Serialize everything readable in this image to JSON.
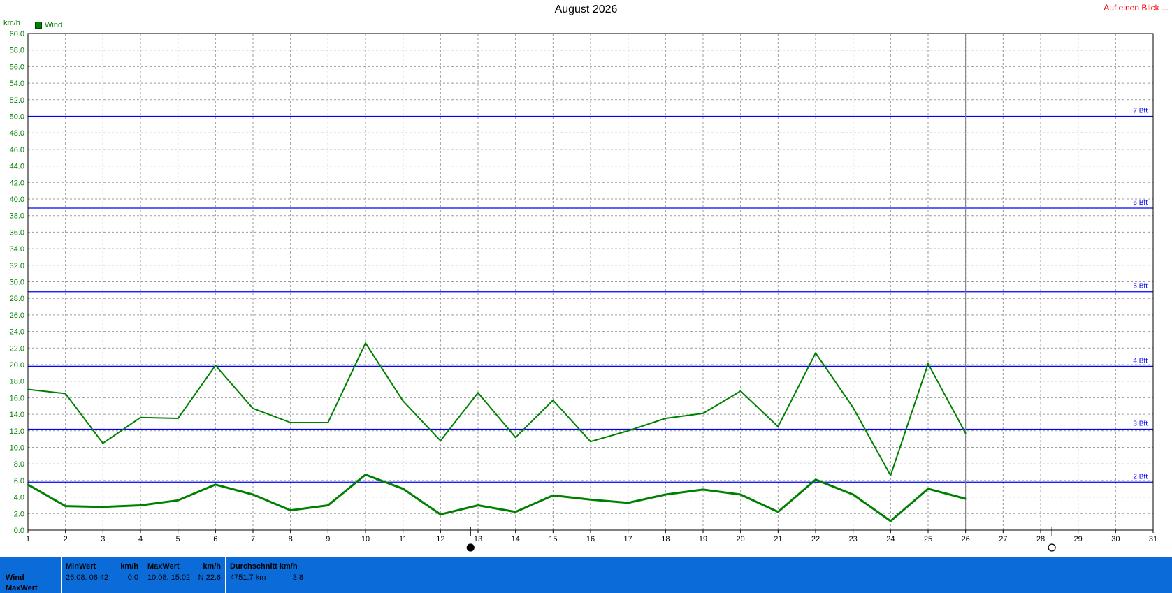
{
  "title": "August 2026",
  "overview_link": "Auf einen Blick ...",
  "unit_label": "km/h",
  "legend": {
    "label": "Wind",
    "color": "#008000"
  },
  "colors": {
    "series": "#008000",
    "beaufort": "#0000ff",
    "grid": "#9a9a9a",
    "panel": "#0a6bd9"
  },
  "chart_data": {
    "type": "line",
    "title": "August 2026",
    "ylabel": "km/h",
    "ylim": [
      0,
      60
    ],
    "yticks": [
      "0.0",
      "2.0",
      "4.0",
      "6.0",
      "8.0",
      "10.0",
      "12.0",
      "14.0",
      "16.0",
      "18.0",
      "20.0",
      "22.0",
      "24.0",
      "26.0",
      "28.0",
      "30.0",
      "32.0",
      "34.0",
      "36.0",
      "38.0",
      "40.0",
      "42.0",
      "44.0",
      "46.0",
      "48.0",
      "50.0",
      "52.0",
      "54.0",
      "56.0",
      "58.0",
      "60.0"
    ],
    "x": [
      1,
      2,
      3,
      4,
      5,
      6,
      7,
      8,
      9,
      10,
      11,
      12,
      13,
      14,
      15,
      16,
      17,
      18,
      19,
      20,
      21,
      22,
      23,
      24,
      25,
      26,
      27,
      28,
      29,
      30,
      31
    ],
    "xlim": [
      1,
      31
    ],
    "grid": true,
    "legend_position": "top-left",
    "series": [
      {
        "name": "Wind",
        "style": "max",
        "x": [
          1,
          2,
          3,
          4,
          5,
          6,
          7,
          8,
          9,
          10,
          11,
          12,
          13,
          14,
          15,
          16,
          17,
          18,
          19,
          20,
          21,
          22,
          23,
          24,
          25,
          26
        ],
        "values": [
          17.0,
          16.5,
          10.5,
          13.6,
          13.5,
          19.9,
          14.7,
          13.0,
          13.0,
          22.6,
          15.6,
          10.8,
          16.6,
          11.2,
          15.7,
          10.7,
          12.0,
          13.5,
          14.1,
          16.8,
          12.5,
          21.4,
          14.8,
          6.6,
          20.1,
          11.7
        ]
      },
      {
        "style": "avg",
        "x": [
          1,
          2,
          3,
          4,
          5,
          6,
          7,
          8,
          9,
          10,
          11,
          12,
          13,
          14,
          15,
          16,
          17,
          18,
          19,
          20,
          21,
          22,
          23,
          24,
          25,
          26
        ],
        "values": [
          5.5,
          2.9,
          2.8,
          3.0,
          3.6,
          5.5,
          4.3,
          2.4,
          3.0,
          6.7,
          5.0,
          1.9,
          3.0,
          2.2,
          4.2,
          3.7,
          3.3,
          4.3,
          4.9,
          4.3,
          2.2,
          6.1,
          4.3,
          1.1,
          5.0,
          3.8
        ]
      }
    ],
    "annotations": [
      {
        "label": "2 Bft",
        "y": 5.8
      },
      {
        "label": "3 Bft",
        "y": 12.2
      },
      {
        "label": "4 Bft",
        "y": 19.8
      },
      {
        "label": "5 Bft",
        "y": 28.8
      },
      {
        "label": "6 Bft",
        "y": 38.9
      },
      {
        "label": "7 Bft",
        "y": 50.0
      }
    ],
    "today_x": 26,
    "moon_phases": [
      {
        "x": 12.8,
        "phase": "full-moon"
      },
      {
        "x": 28.3,
        "phase": "new-moon"
      }
    ]
  },
  "stats": {
    "row_labels": [
      "Wind",
      "MaxWert"
    ],
    "min": {
      "header": "MinWert",
      "unit": "km/h",
      "date": "26.08.  06:42",
      "value": "0.0"
    },
    "max": {
      "header": "MaxWert",
      "unit": "km/h",
      "date": "10.08.  15:02",
      "value": "N 22.6"
    },
    "avg": {
      "header": "Durchschnitt km/h",
      "distance": "4751.7 km",
      "value": "3.8"
    }
  }
}
